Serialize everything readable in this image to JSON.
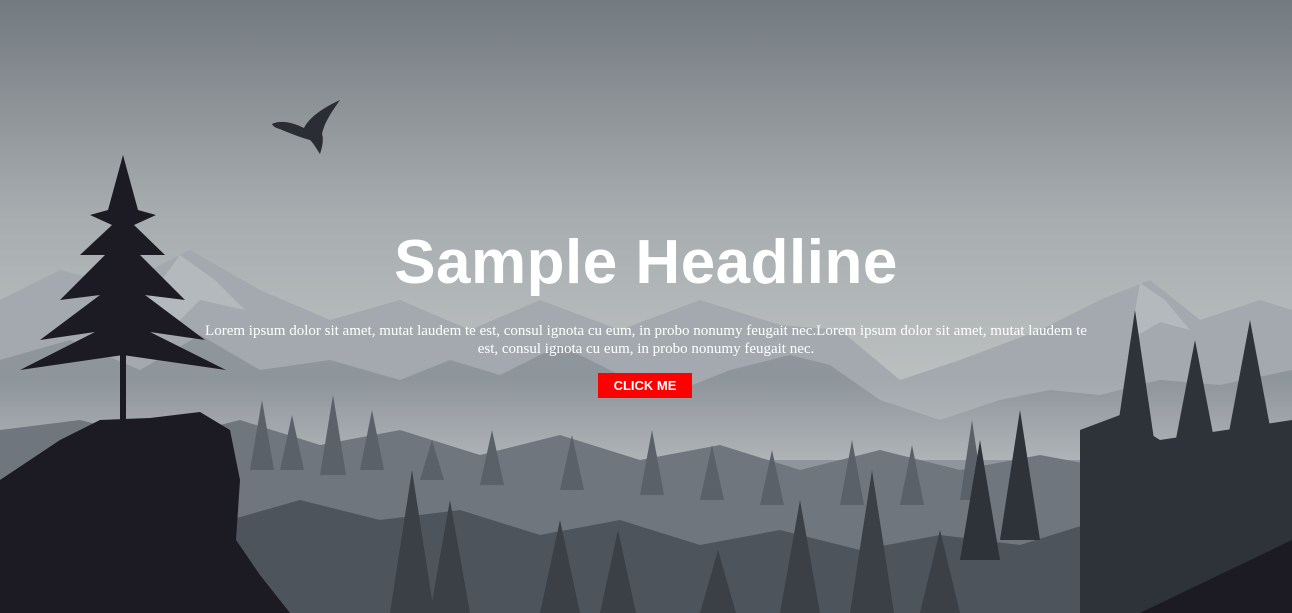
{
  "hero": {
    "headline": "Sample Headline",
    "paragraph": "Lorem ipsum dolor sit amet, mutat laudem te est, consul ignota cu eum, in probo nonumy feugait nec.Lorem ipsum dolor sit amet, mutat laudem te est, consul ignota cu eum, in probo nonumy feugait nec.",
    "button_label": "CLICK ME"
  },
  "colors": {
    "button_bg": "#ff0000",
    "text": "#ffffff",
    "sky_top": "#737a80",
    "sky_mid": "#b6bbbd",
    "tree_dark": "#1c1a23"
  },
  "icons": {
    "bird": "eagle-icon"
  }
}
